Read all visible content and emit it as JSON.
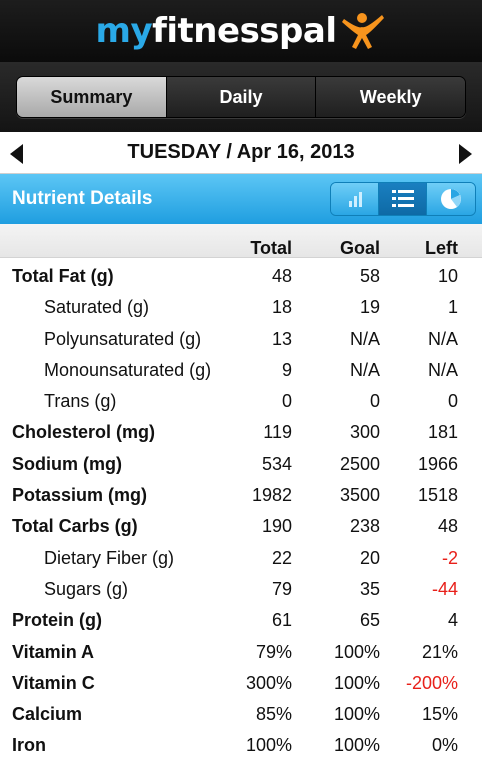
{
  "app": {
    "logo_text": "myfitnesspal"
  },
  "tabs": [
    {
      "label": "Summary",
      "active": true
    },
    {
      "label": "Daily",
      "active": false
    },
    {
      "label": "Weekly",
      "active": false
    }
  ],
  "date": {
    "label": "TUESDAY / Apr 16, 2013"
  },
  "section": {
    "title": "Nutrient Details",
    "views": [
      "bar-chart-icon",
      "list-icon",
      "pie-chart-icon"
    ],
    "active_view": "list-icon"
  },
  "table": {
    "headers": {
      "total": "Total",
      "goal": "Goal",
      "left": "Left"
    },
    "rows": [
      {
        "label": "Total Fat (g)",
        "total": "48",
        "goal": "58",
        "left": "10",
        "bold": true
      },
      {
        "label": "Saturated (g)",
        "total": "18",
        "goal": "19",
        "left": "1",
        "sub": true
      },
      {
        "label": "Polyunsaturated (g)",
        "total": "13",
        "goal": "N/A",
        "left": "N/A",
        "sub": true
      },
      {
        "label": "Monounsaturated (g)",
        "total": "9",
        "goal": "N/A",
        "left": "N/A",
        "sub": true
      },
      {
        "label": "Trans (g)",
        "total": "0",
        "goal": "0",
        "left": "0",
        "sub": true
      },
      {
        "label": "Cholesterol (mg)",
        "total": "119",
        "goal": "300",
        "left": "181",
        "bold": true
      },
      {
        "label": "Sodium (mg)",
        "total": "534",
        "goal": "2500",
        "left": "1966",
        "bold": true
      },
      {
        "label": "Potassium (mg)",
        "total": "1982",
        "goal": "3500",
        "left": "1518",
        "bold": true
      },
      {
        "label": "Total Carbs (g)",
        "total": "190",
        "goal": "238",
        "left": "48",
        "bold": true
      },
      {
        "label": "Dietary Fiber (g)",
        "total": "22",
        "goal": "20",
        "left": "-2",
        "sub": true,
        "negative": true
      },
      {
        "label": "Sugars (g)",
        "total": "79",
        "goal": "35",
        "left": "-44",
        "sub": true,
        "negative": true
      },
      {
        "label": "Protein (g)",
        "total": "61",
        "goal": "65",
        "left": "4",
        "bold": true
      },
      {
        "label": "Vitamin A",
        "total": "79%",
        "goal": "100%",
        "left": "21%",
        "bold": true
      },
      {
        "label": "Vitamin C",
        "total": "300%",
        "goal": "100%",
        "left": "-200%",
        "bold": true,
        "negative": true
      },
      {
        "label": "Calcium",
        "total": "85%",
        "goal": "100%",
        "left": "15%",
        "bold": true
      },
      {
        "label": "Iron",
        "total": "100%",
        "goal": "100%",
        "left": "0%",
        "bold": true
      }
    ]
  },
  "colors": {
    "accent": "#2aa9e7",
    "negative": "#e8201a",
    "section_bar": "#1f9ee0"
  }
}
